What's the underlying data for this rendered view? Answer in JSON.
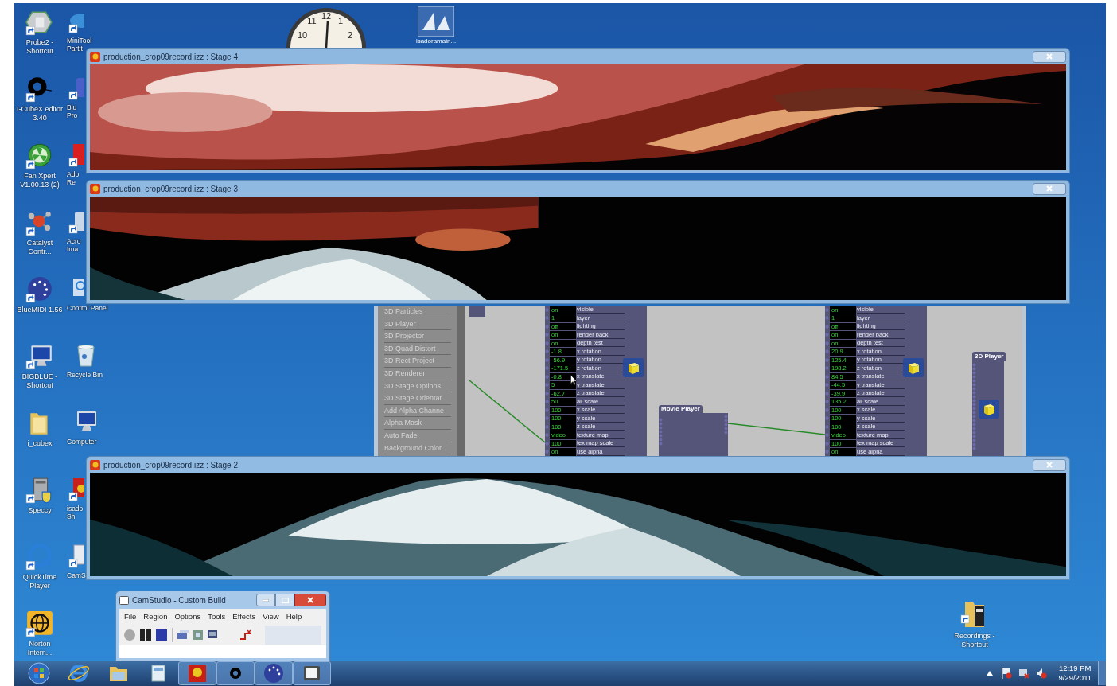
{
  "desktop_icons_left": [
    {
      "label": "Probe2 - Shortcut"
    },
    {
      "label": "I-CubeX editor 3.40"
    },
    {
      "label": "Fan Xpert V1.00.13 (2)"
    },
    {
      "label": "Catalyst Contr..."
    },
    {
      "label": "BlueMIDI 1.56"
    },
    {
      "label": "BIGBLUE - Shortcut"
    },
    {
      "label": "i_cubex"
    },
    {
      "label": "Speccy"
    },
    {
      "label": "QuickTime Player"
    },
    {
      "label": "Norton Intern..."
    }
  ],
  "desktop_icons_right": [
    {
      "lines": [
        "MiniTool",
        "Partit"
      ]
    },
    {
      "lines": [
        "Blu",
        "Pro"
      ]
    },
    {
      "lines": [
        "Ado",
        "Re"
      ]
    },
    {
      "lines": [
        "Acro",
        "Ima"
      ]
    },
    {
      "lines": [
        "Control Panel"
      ]
    },
    {
      "lines": [
        "Recycle Bin"
      ]
    },
    {
      "lines": [
        "Computer"
      ]
    },
    {
      "lines": [
        "isado",
        "Sh"
      ]
    },
    {
      "lines": [
        "CamS"
      ]
    }
  ],
  "clock": {
    "numerals": [
      "10",
      "11",
      "12",
      "1",
      "2"
    ]
  },
  "top_icon": {
    "label": "isadoramain..."
  },
  "stage_windows": [
    {
      "title": "production_crop09record.izz : Stage 4"
    },
    {
      "title": "production_crop09record.izz : Stage 3"
    },
    {
      "title": "production_crop09record.izz : Stage 2"
    }
  ],
  "patch_window": {
    "actor_list": [
      "3D Particles",
      "3D Player",
      "3D Projector",
      "3D Quad Distort",
      "3D Rect Project",
      "3D Renderer",
      "3D Stage Options",
      "3D Stage Orientat",
      "Add Alpha Channe",
      "Alpha Mask",
      "Auto Fade",
      "Background Color"
    ],
    "actors": [
      {
        "rows": [
          {
            "value": "on",
            "label": "visible"
          },
          {
            "value": "1",
            "label": "layer"
          },
          {
            "value": "off",
            "label": "lighting"
          },
          {
            "value": "on",
            "label": "render back"
          },
          {
            "value": "on",
            "label": "depth test"
          },
          {
            "value": "-1.8",
            "label": "x rotation"
          },
          {
            "value": "-56.9",
            "label": "y rotation"
          },
          {
            "value": "-171.5",
            "label": "z rotation"
          },
          {
            "value": "-0.8",
            "label": "x translate"
          },
          {
            "value": "5",
            "label": "y translate"
          },
          {
            "value": "-62.7",
            "label": "z translate"
          },
          {
            "value": "50",
            "label": "all scale"
          },
          {
            "value": "100",
            "label": "x scale"
          },
          {
            "value": "100",
            "label": "y scale"
          },
          {
            "value": "100",
            "label": "z scale"
          },
          {
            "value": "video",
            "label": "texture map"
          },
          {
            "value": "100",
            "label": "tex map scale"
          },
          {
            "value": "on",
            "label": "use alpha"
          }
        ]
      },
      {
        "rows": [
          {
            "value": "on",
            "label": "visible"
          },
          {
            "value": "1",
            "label": "layer"
          },
          {
            "value": "off",
            "label": "lighting"
          },
          {
            "value": "on",
            "label": "render back"
          },
          {
            "value": "on",
            "label": "depth test"
          },
          {
            "value": "20.9",
            "label": "x rotation"
          },
          {
            "value": "125.4",
            "label": "y rotation"
          },
          {
            "value": "198.2",
            "label": "z rotation"
          },
          {
            "value": "84.5",
            "label": "x translate"
          },
          {
            "value": "-44.5",
            "label": "y translate"
          },
          {
            "value": "-39.9",
            "label": "z translate"
          },
          {
            "value": "135.2",
            "label": "all scale"
          },
          {
            "value": "100",
            "label": "x scale"
          },
          {
            "value": "100",
            "label": "y scale"
          },
          {
            "value": "100",
            "label": "z scale"
          },
          {
            "value": "video",
            "label": "texture map"
          },
          {
            "value": "100",
            "label": "tex map scale"
          },
          {
            "value": "on",
            "label": "use alpha"
          }
        ]
      }
    ],
    "nodes": [
      {
        "title": "Movie Player"
      },
      {
        "title": "3D Player"
      }
    ]
  },
  "camstudio": {
    "title": "CamStudio - Custom Build",
    "menu": [
      "File",
      "Region",
      "Options",
      "Tools",
      "Effects",
      "View",
      "Help"
    ]
  },
  "recordings_icon": {
    "label": "Recordings - Shortcut"
  },
  "taskbar": {
    "buttons": [
      {
        "open": false
      },
      {
        "open": false
      },
      {
        "open": false
      },
      {
        "open": false
      },
      {
        "open": true
      },
      {
        "open": true
      },
      {
        "open": true
      },
      {
        "open": true
      }
    ],
    "time": "12:19 PM",
    "date": "9/29/2011"
  }
}
